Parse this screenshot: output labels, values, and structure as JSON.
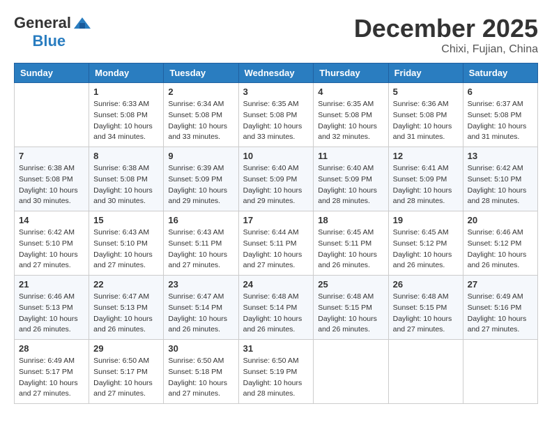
{
  "header": {
    "logo_general": "General",
    "logo_blue": "Blue",
    "month_title": "December 2025",
    "location": "Chixi, Fujian, China"
  },
  "days_of_week": [
    "Sunday",
    "Monday",
    "Tuesday",
    "Wednesday",
    "Thursday",
    "Friday",
    "Saturday"
  ],
  "weeks": [
    [
      {
        "day": "",
        "info": ""
      },
      {
        "day": "1",
        "info": "Sunrise: 6:33 AM\nSunset: 5:08 PM\nDaylight: 10 hours\nand 34 minutes."
      },
      {
        "day": "2",
        "info": "Sunrise: 6:34 AM\nSunset: 5:08 PM\nDaylight: 10 hours\nand 33 minutes."
      },
      {
        "day": "3",
        "info": "Sunrise: 6:35 AM\nSunset: 5:08 PM\nDaylight: 10 hours\nand 33 minutes."
      },
      {
        "day": "4",
        "info": "Sunrise: 6:35 AM\nSunset: 5:08 PM\nDaylight: 10 hours\nand 32 minutes."
      },
      {
        "day": "5",
        "info": "Sunrise: 6:36 AM\nSunset: 5:08 PM\nDaylight: 10 hours\nand 31 minutes."
      },
      {
        "day": "6",
        "info": "Sunrise: 6:37 AM\nSunset: 5:08 PM\nDaylight: 10 hours\nand 31 minutes."
      }
    ],
    [
      {
        "day": "7",
        "info": "Sunrise: 6:38 AM\nSunset: 5:08 PM\nDaylight: 10 hours\nand 30 minutes."
      },
      {
        "day": "8",
        "info": "Sunrise: 6:38 AM\nSunset: 5:08 PM\nDaylight: 10 hours\nand 30 minutes."
      },
      {
        "day": "9",
        "info": "Sunrise: 6:39 AM\nSunset: 5:09 PM\nDaylight: 10 hours\nand 29 minutes."
      },
      {
        "day": "10",
        "info": "Sunrise: 6:40 AM\nSunset: 5:09 PM\nDaylight: 10 hours\nand 29 minutes."
      },
      {
        "day": "11",
        "info": "Sunrise: 6:40 AM\nSunset: 5:09 PM\nDaylight: 10 hours\nand 28 minutes."
      },
      {
        "day": "12",
        "info": "Sunrise: 6:41 AM\nSunset: 5:09 PM\nDaylight: 10 hours\nand 28 minutes."
      },
      {
        "day": "13",
        "info": "Sunrise: 6:42 AM\nSunset: 5:10 PM\nDaylight: 10 hours\nand 28 minutes."
      }
    ],
    [
      {
        "day": "14",
        "info": "Sunrise: 6:42 AM\nSunset: 5:10 PM\nDaylight: 10 hours\nand 27 minutes."
      },
      {
        "day": "15",
        "info": "Sunrise: 6:43 AM\nSunset: 5:10 PM\nDaylight: 10 hours\nand 27 minutes."
      },
      {
        "day": "16",
        "info": "Sunrise: 6:43 AM\nSunset: 5:11 PM\nDaylight: 10 hours\nand 27 minutes."
      },
      {
        "day": "17",
        "info": "Sunrise: 6:44 AM\nSunset: 5:11 PM\nDaylight: 10 hours\nand 27 minutes."
      },
      {
        "day": "18",
        "info": "Sunrise: 6:45 AM\nSunset: 5:11 PM\nDaylight: 10 hours\nand 26 minutes."
      },
      {
        "day": "19",
        "info": "Sunrise: 6:45 AM\nSunset: 5:12 PM\nDaylight: 10 hours\nand 26 minutes."
      },
      {
        "day": "20",
        "info": "Sunrise: 6:46 AM\nSunset: 5:12 PM\nDaylight: 10 hours\nand 26 minutes."
      }
    ],
    [
      {
        "day": "21",
        "info": "Sunrise: 6:46 AM\nSunset: 5:13 PM\nDaylight: 10 hours\nand 26 minutes."
      },
      {
        "day": "22",
        "info": "Sunrise: 6:47 AM\nSunset: 5:13 PM\nDaylight: 10 hours\nand 26 minutes."
      },
      {
        "day": "23",
        "info": "Sunrise: 6:47 AM\nSunset: 5:14 PM\nDaylight: 10 hours\nand 26 minutes."
      },
      {
        "day": "24",
        "info": "Sunrise: 6:48 AM\nSunset: 5:14 PM\nDaylight: 10 hours\nand 26 minutes."
      },
      {
        "day": "25",
        "info": "Sunrise: 6:48 AM\nSunset: 5:15 PM\nDaylight: 10 hours\nand 26 minutes."
      },
      {
        "day": "26",
        "info": "Sunrise: 6:48 AM\nSunset: 5:15 PM\nDaylight: 10 hours\nand 27 minutes."
      },
      {
        "day": "27",
        "info": "Sunrise: 6:49 AM\nSunset: 5:16 PM\nDaylight: 10 hours\nand 27 minutes."
      }
    ],
    [
      {
        "day": "28",
        "info": "Sunrise: 6:49 AM\nSunset: 5:17 PM\nDaylight: 10 hours\nand 27 minutes."
      },
      {
        "day": "29",
        "info": "Sunrise: 6:50 AM\nSunset: 5:17 PM\nDaylight: 10 hours\nand 27 minutes."
      },
      {
        "day": "30",
        "info": "Sunrise: 6:50 AM\nSunset: 5:18 PM\nDaylight: 10 hours\nand 27 minutes."
      },
      {
        "day": "31",
        "info": "Sunrise: 6:50 AM\nSunset: 5:19 PM\nDaylight: 10 hours\nand 28 minutes."
      },
      {
        "day": "",
        "info": ""
      },
      {
        "day": "",
        "info": ""
      },
      {
        "day": "",
        "info": ""
      }
    ]
  ]
}
